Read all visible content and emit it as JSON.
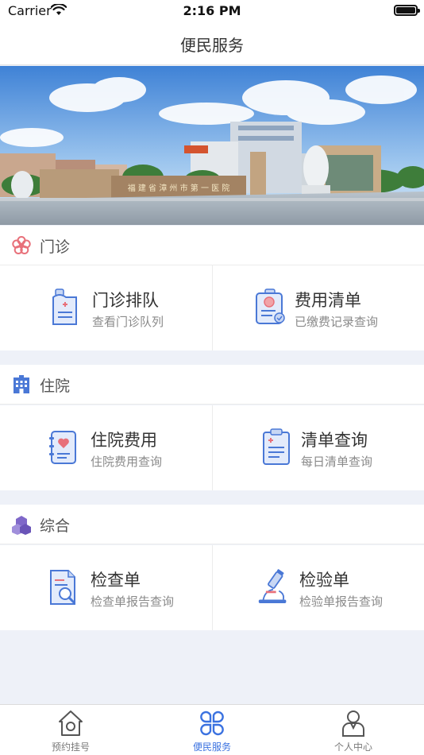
{
  "status_bar": {
    "carrier": "Carrier",
    "time": "2:16 PM"
  },
  "nav": {
    "title": "便民服务"
  },
  "banner": {
    "gate_sign": "福 建 省 漳 州 市 第 一 医 院"
  },
  "sections": [
    {
      "title": "门诊",
      "icon": "flower-icon",
      "cards": [
        {
          "title": "门诊排队",
          "subtitle": "查看门诊队列",
          "icon": "queue-tag-icon"
        },
        {
          "title": "费用清单",
          "subtitle": "已缴费记录查询",
          "icon": "fee-list-icon"
        }
      ]
    },
    {
      "title": "住院",
      "icon": "hospital-building-icon",
      "cards": [
        {
          "title": "住院费用",
          "subtitle": "住院费用查询",
          "icon": "heart-notebook-icon"
        },
        {
          "title": "清单查询",
          "subtitle": "每日清单查询",
          "icon": "clipboard-icon"
        }
      ]
    },
    {
      "title": "综合",
      "icon": "cubes-icon",
      "cards": [
        {
          "title": "检查单",
          "subtitle": "检查单报告查询",
          "icon": "document-search-icon"
        },
        {
          "title": "检验单",
          "subtitle": "检验单报告查询",
          "icon": "microscope-icon"
        }
      ]
    }
  ],
  "tabs": [
    {
      "label": "预约挂号",
      "icon": "home-icon",
      "active": false
    },
    {
      "label": "便民服务",
      "icon": "clover-icon",
      "active": true
    },
    {
      "label": "个人中心",
      "icon": "person-icon",
      "active": false
    }
  ],
  "colors": {
    "accent": "#3b72e0",
    "icon_blue": "#4a78d6",
    "section_red": "#e8707a",
    "section_purple": "#7f68c9",
    "background": "#eef1f8"
  }
}
